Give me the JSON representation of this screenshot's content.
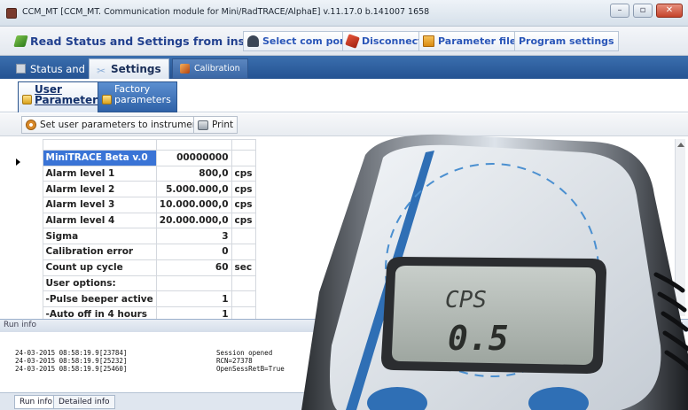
{
  "window": {
    "title": "CCM_MT [CCM_MT. Communication module for Mini/RadTRACE/AlphaE] v.11.17.0 b.141007 1658",
    "controls": [
      "–",
      "▫",
      "✕"
    ]
  },
  "toolbar": {
    "read_status": "Read Status and Settings from instrument",
    "select_com_port": "Select com port",
    "disconnect": "Disconnect",
    "parameter_files": "Parameter files",
    "program_settings": "Program settings"
  },
  "main_tabs": [
    "Status and",
    "Settings",
    "Calibration"
  ],
  "sub_tabs": [
    {
      "line1": "User",
      "line2": "Parameters"
    },
    {
      "line1": "Factory",
      "line2": "parameters"
    }
  ],
  "actions": {
    "set_user_params": "Set user parameters to instrument",
    "print": "Print"
  },
  "grid": {
    "rows": [
      {
        "name": "MiniTRACE Beta v.0",
        "value": "00000000",
        "unit": ""
      },
      {
        "name": "Alarm level 1",
        "value": "800,0",
        "unit": "cps"
      },
      {
        "name": "Alarm level 2",
        "value": "5.000.000,0",
        "unit": "cps"
      },
      {
        "name": "Alarm level 3",
        "value": "10.000.000,0",
        "unit": "cps"
      },
      {
        "name": "Alarm level 4",
        "value": "20.000.000,0",
        "unit": "cps"
      },
      {
        "name": "Sigma",
        "value": "3",
        "unit": ""
      },
      {
        "name": "Calibration error",
        "value": "0",
        "unit": ""
      },
      {
        "name": "Count up cycle",
        "value": "60",
        "unit": "sec"
      },
      {
        "name": "User options:",
        "value": "",
        "unit": ""
      },
      {
        "name": " -Pulse beeper active",
        "value": "1",
        "unit": ""
      },
      {
        "name": " -Auto off in 4 hours",
        "value": "1",
        "unit": ""
      }
    ]
  },
  "run_info": {
    "header": "Run info",
    "lines": [
      {
        "time": "24-03-2015 08:58:19.9[23784]",
        "msg": "Session opened"
      },
      {
        "time": "24-03-2015 08:58:19.9[25232]",
        "msg": "RCN=27378"
      },
      {
        "time": "24-03-2015 08:58:19.9[25460]",
        "msg": "OpenSessRetB=True"
      }
    ]
  },
  "bottom_tabs": [
    "Run info",
    "Detailed info"
  ],
  "device": {
    "display_unit": "CPS",
    "display_value": "0.5"
  },
  "colors": {
    "tab_strip": "#2f5f9f",
    "selected_cell": "#3a74d6",
    "toolbar_text": "#2a56b8"
  }
}
